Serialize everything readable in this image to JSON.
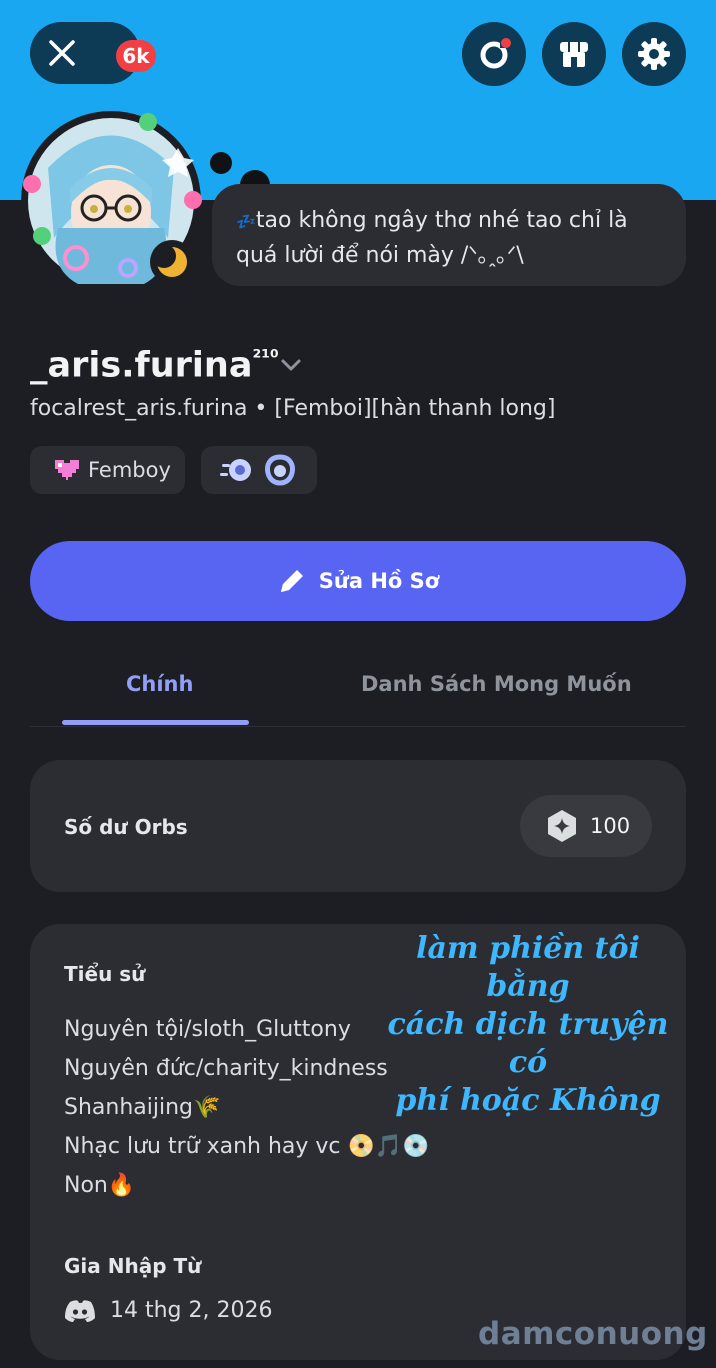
{
  "header": {
    "notification_count": "6k",
    "colors": {
      "banner": "#1aa7f2",
      "button_bg": "#0d3a55",
      "badge": "#f23f43"
    }
  },
  "status_bubble": {
    "emoji": "💤",
    "text": "tao không ngây thơ nhé tao chỉ là quá lười để nói mày /ᐠ｡ꞈ｡ᐟ\\"
  },
  "profile": {
    "display_name": "_aris.furina",
    "display_name_suffix": "²¹⁰",
    "subline": "focalrest_aris.furina • [Femboi][hàn thanh long]",
    "tag_label": "Femboy"
  },
  "edit_button": {
    "label": "Sửa Hồ Sơ"
  },
  "tabs": [
    {
      "label": "Chính",
      "active": true
    },
    {
      "label": "Danh Sách Mong Muốn",
      "active": false
    }
  ],
  "orbs": {
    "label": "Số dư Orbs",
    "value": "100"
  },
  "bio": {
    "heading": "Tiểu sử",
    "lines": [
      "Nguyên tội/sloth_Gluttony",
      "Nguyên đức/charity_kindness",
      "Shanhaijing🌾",
      "Nhạc lưu trữ xanh hay vc 📀🎵💿",
      "Non🔥"
    ]
  },
  "member_since": {
    "heading": "Gia Nhập Từ",
    "date": "14 thg 2, 2026"
  },
  "overlay": {
    "line1": "làm phiền tôi bằng",
    "line2": "cách dịch truyện có",
    "line3": "phí hoặc Không"
  },
  "watermark": "damconuong",
  "accent_color": "#5865f2"
}
